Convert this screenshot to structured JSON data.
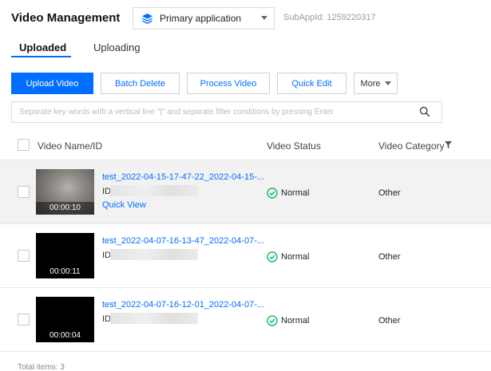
{
  "header": {
    "title": "Video Management",
    "app_select": {
      "value": "Primary application",
      "icon": "app-stack-icon"
    },
    "subappid": "SubAppId: 1259220317"
  },
  "tabs": [
    {
      "label": "Uploaded",
      "active": true
    },
    {
      "label": "Uploading",
      "active": false
    }
  ],
  "toolbar": {
    "upload": "Upload Video",
    "batch_delete": "Batch Delete",
    "process": "Process Video",
    "quick_edit": "Quick Edit",
    "more": "More"
  },
  "search": {
    "placeholder": "Separate key words with a vertical line \"|\" and separate filter conditions by pressing Enter",
    "value": ""
  },
  "table": {
    "columns": [
      "Video Name/ID",
      "Video Status",
      "Video Category"
    ],
    "rows": [
      {
        "name": "test_2022-04-15-17-47-22_2022-04-15-...",
        "id_prefix": "ID",
        "duration": "00:00:10",
        "quick_view": "Quick View",
        "status": "Normal",
        "category": "Other"
      },
      {
        "name": "test_2022-04-07-16-13-47_2022-04-07-...",
        "id_prefix": "ID",
        "duration": "00:00:11",
        "status": "Normal",
        "category": "Other"
      },
      {
        "name": "test_2022-04-07-16-12-01_2022-04-07-...",
        "id_prefix": "ID",
        "duration": "00:00:04",
        "status": "Normal",
        "category": "Other"
      }
    ],
    "total": "Total items: 3"
  },
  "colors": {
    "accent": "#006eff",
    "success": "#0abf5b"
  }
}
